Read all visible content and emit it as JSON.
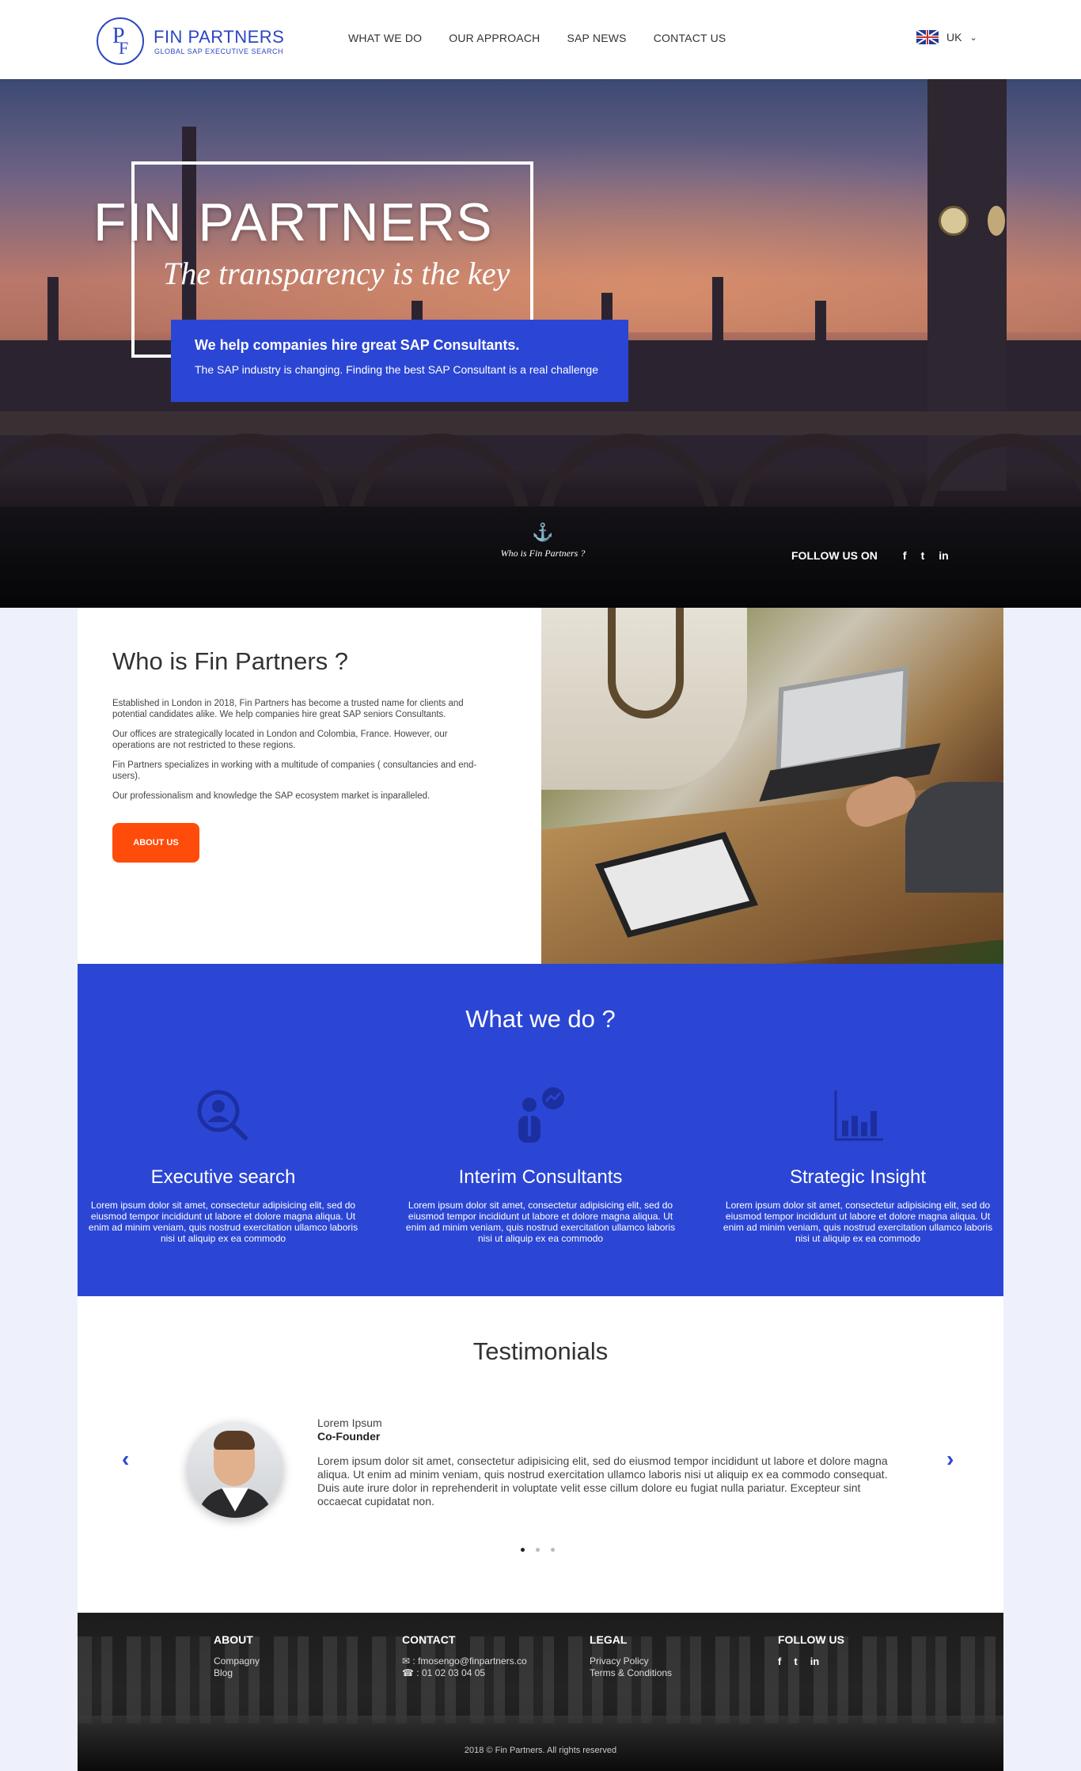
{
  "header": {
    "logo_name": "FIN PARTNERS",
    "logo_tagline": "GLOBAL SAP EXECUTIVE SEARCH",
    "nav": [
      "WHAT WE DO",
      "OUR APPROACH",
      "SAP NEWS",
      "CONTACT US"
    ],
    "lang": "UK"
  },
  "hero": {
    "title": "FIN PARTNERS",
    "subtitle": "The transparency is the key",
    "box_heading": "We help companies hire great SAP Consultants.",
    "box_text": "The SAP industry is changing. Finding the best SAP Consultant is a real challenge",
    "who_link": "Who is Fin Partners ?",
    "follow_label": "FOLLOW US ON",
    "social": [
      "f",
      "t",
      "in"
    ]
  },
  "who": {
    "title": "Who is Fin Partners ?",
    "paragraphs": [
      "Established in London in 2018, Fin Partners has become a trusted name for clients and potential candidates alike. We help companies hire great SAP seniors Consultants.",
      "Our offices are strategically located in London and Colombia, France. However, our operations are not restricted to these regions.",
      "Fin Partners specializes in working with a multitude of companies ( consultancies and end-users).",
      "Our professionalism and knowledge the SAP ecosystem market is inparalleled."
    ],
    "button": "ABOUT US"
  },
  "what_we_do": {
    "title": "What we do ?",
    "services": [
      {
        "icon": "search-person-icon",
        "title": "Executive search",
        "desc": "Lorem ipsum dolor sit amet, consectetur adipisicing elit, sed do eiusmod tempor incididunt ut labore et dolore magna aliqua. Ut enim ad minim veniam, quis nostrud exercitation ullamco laboris nisi ut aliquip ex ea commodo"
      },
      {
        "icon": "consultant-chart-icon",
        "title": "Interim Consultants",
        "desc": "Lorem ipsum dolor sit amet, consectetur adipisicing elit, sed do eiusmod tempor incididunt ut labore et dolore magna aliqua. Ut enim ad minim veniam, quis nostrud exercitation ullamco laboris nisi ut aliquip ex ea commodo"
      },
      {
        "icon": "bar-chart-icon",
        "title": "Strategic Insight",
        "desc": "Lorem ipsum dolor sit amet, consectetur adipisicing elit, sed do eiusmod tempor incididunt ut labore et dolore magna aliqua. Ut enim ad minim veniam, quis nostrud exercitation ullamco laboris nisi ut aliquip ex ea commodo"
      }
    ]
  },
  "testimonials": {
    "title": "Testimonials",
    "name": "Lorem Ipsum",
    "role": "Co-Founder",
    "quote": "Lorem ipsum dolor sit amet, consectetur adipisicing elit, sed do eiusmod tempor incididunt ut labore et dolore magna aliqua. Ut enim ad minim veniam, quis nostrud exercitation ullamco laboris nisi ut aliquip ex ea commodo consequat. Duis aute irure dolor in reprehenderit in voluptate velit esse cillum dolore eu fugiat nulla pariatur. Excepteur sint occaecat cupidatat non.",
    "prev": "‹",
    "next": "›",
    "active_dot": 0
  },
  "footer": {
    "about_title": "ABOUT",
    "about_links": [
      "Compagny",
      "Blog"
    ],
    "contact_title": "CONTACT",
    "email": "fmosengo@finpartners.co",
    "phone": "01 02 03 04 05",
    "legal_title": "LEGAL",
    "legal_links": [
      "Privacy Policy",
      "Terms & Conditions"
    ],
    "follow_title": "FOLLOW US",
    "social": [
      "f",
      "t",
      "in"
    ],
    "copyright": "2018 © Fin Partners. All rights reserved"
  },
  "colors": {
    "brand_blue": "#2b46d4",
    "accent_orange": "#ff4c0a"
  }
}
